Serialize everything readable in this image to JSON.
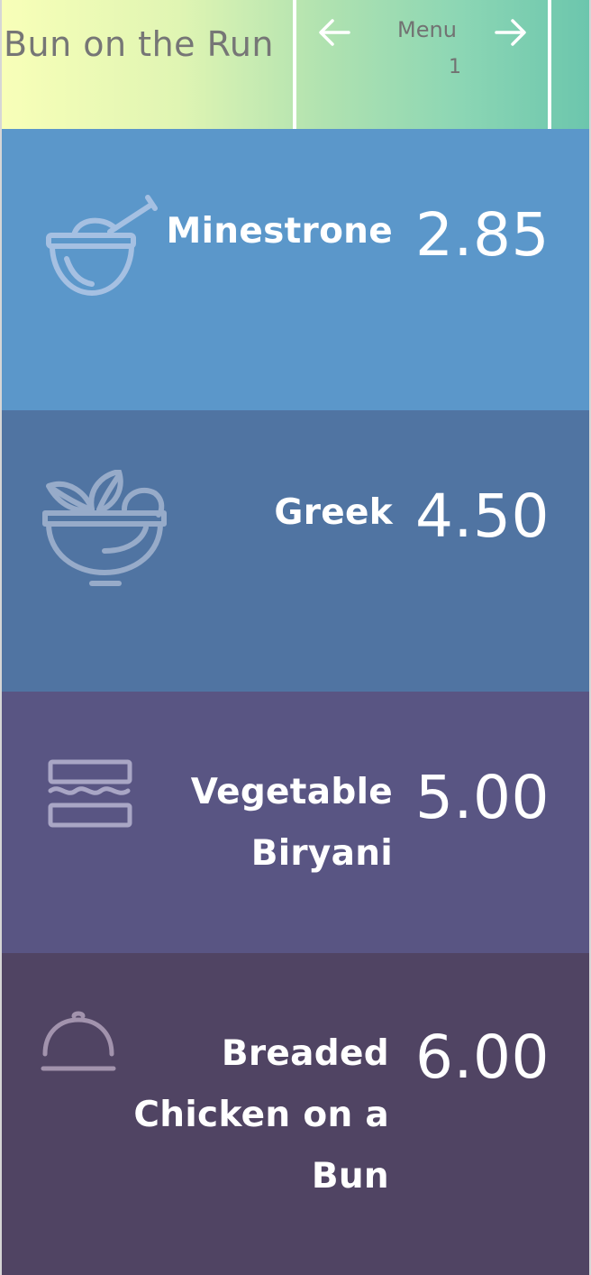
{
  "header": {
    "brand": "Bun on the Run",
    "menu_label": "Menu",
    "page_number": "1",
    "prev_icon": "arrow-left-icon",
    "next_icon": "arrow-right-icon",
    "gradient_start": "#f8ffb8",
    "gradient_end": "#6cc6ad"
  },
  "items": [
    {
      "name": "Minestrone",
      "price": "2.85",
      "icon": "soup-bowl-icon",
      "color": "#5b97ca"
    },
    {
      "name": "Greek",
      "price": "4.50",
      "icon": "salad-bowl-icon",
      "color": "#5074a2"
    },
    {
      "name": "Vegetable Biryani",
      "price": "5.00",
      "icon": "sandwich-icon",
      "color": "#595583"
    },
    {
      "name": "Breaded Chicken on a Bun",
      "price": "6.00",
      "icon": "cloche-icon",
      "color": "#504463"
    }
  ]
}
